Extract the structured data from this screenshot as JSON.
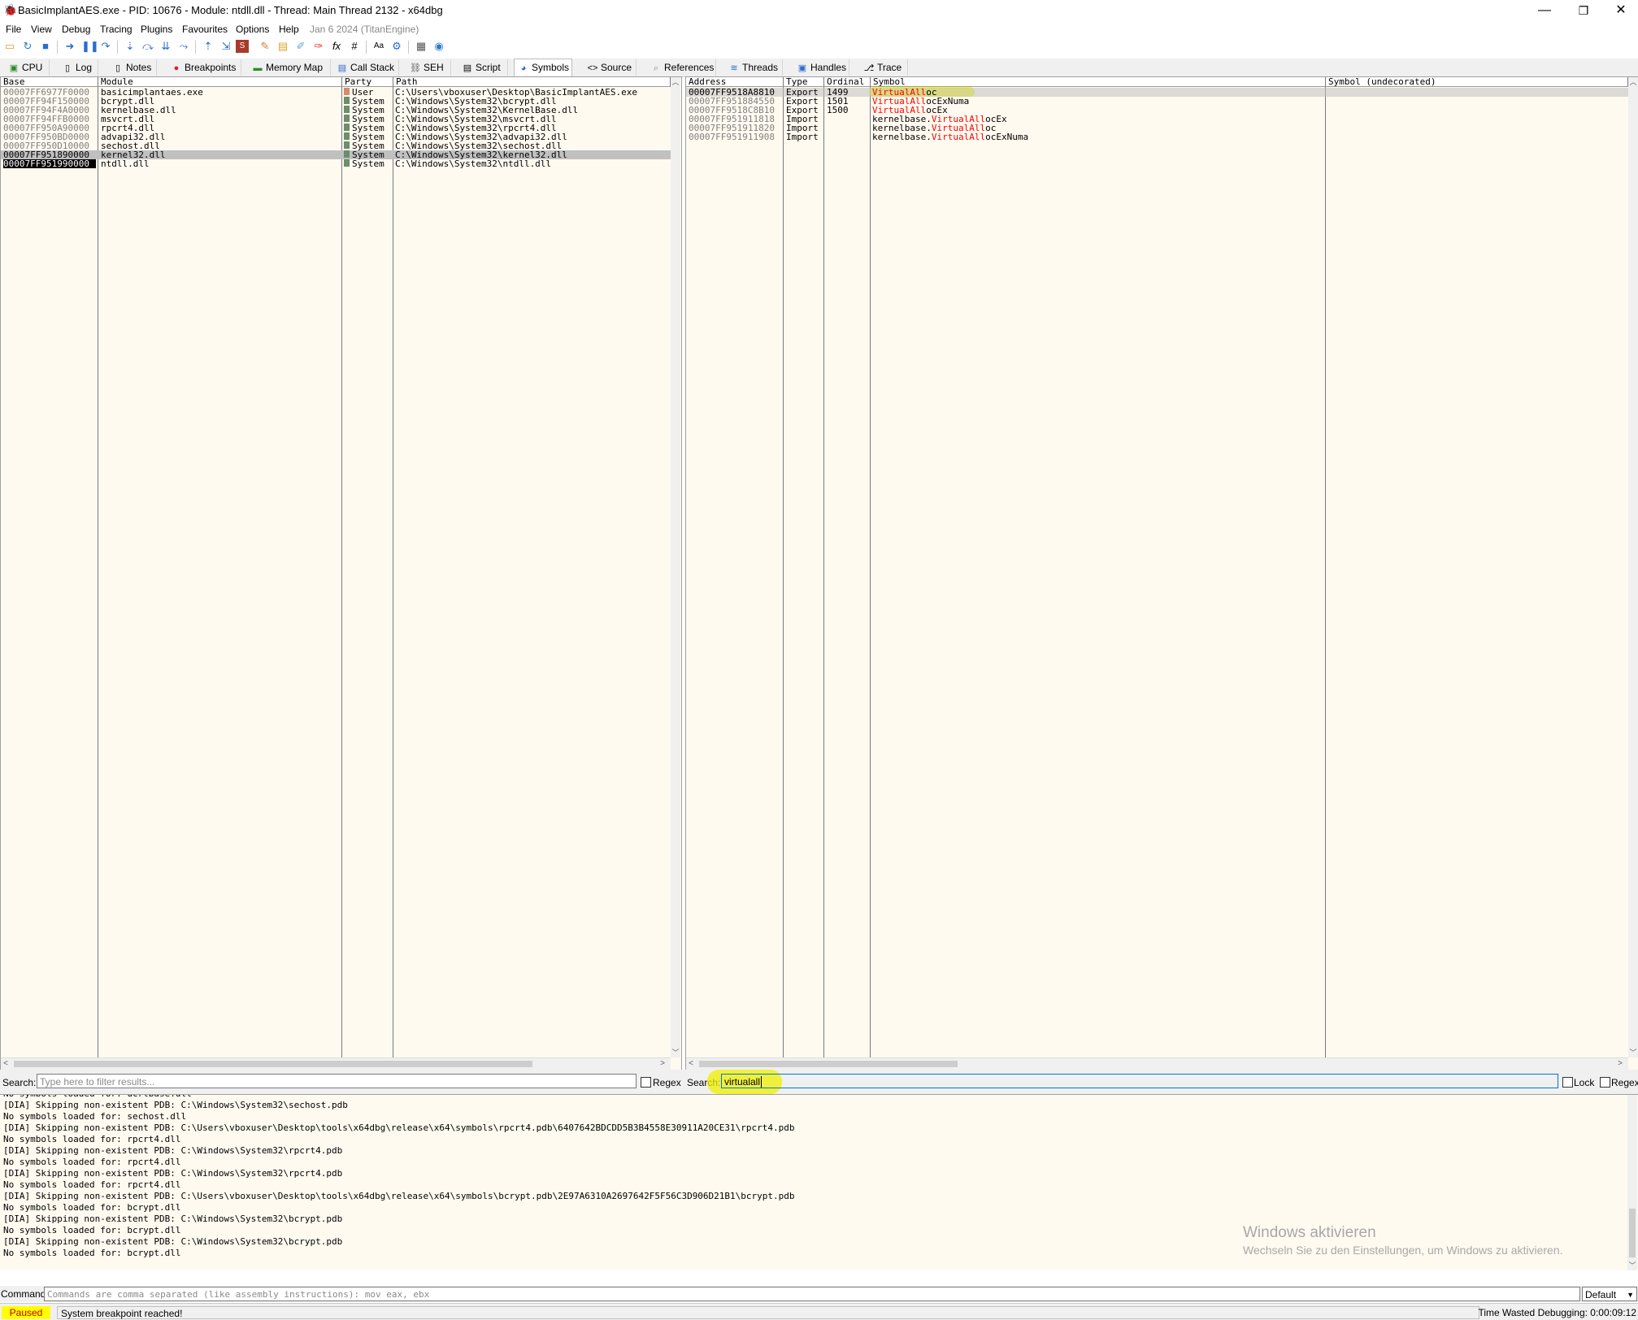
{
  "window": {
    "title": "BasicImplantAES.exe - PID: 10676 - Module: ntdll.dll - Thread: Main Thread 2132 - x64dbg",
    "minimize": "—",
    "restore": "❐",
    "close": "✕"
  },
  "menu": {
    "items": [
      "File",
      "View",
      "Debug",
      "Tracing",
      "Plugins",
      "Favourites",
      "Options",
      "Help"
    ],
    "date": "Jan 6 2024 (TitanEngine)"
  },
  "toolbar": {
    "icons": [
      "open-icon",
      "restart-icon",
      "stop-icon",
      "run-icon",
      "pause-icon",
      "run-until-return-icon",
      "step-into-icon",
      "step-over-icon",
      "trace-into-icon",
      "trace-over-icon",
      "execute-till-return-icon",
      "run-to-user-code-icon",
      "scylla-icon",
      "patch-icon",
      "comments-icon",
      "labels-icon",
      "bookmarks-icon",
      "functions-icon",
      "variables-icon",
      "hash-icon",
      "font-icon",
      "settings-icon",
      "calculator-icon",
      "help-icon"
    ]
  },
  "tabs": [
    {
      "label": "CPU",
      "icon": "cpu-icon"
    },
    {
      "label": "Log",
      "icon": "log-icon"
    },
    {
      "label": "Notes",
      "icon": "notes-icon"
    },
    {
      "label": "Breakpoints",
      "icon": "breakpoint-icon"
    },
    {
      "label": "Memory Map",
      "icon": "memory-icon"
    },
    {
      "label": "Call Stack",
      "icon": "callstack-icon"
    },
    {
      "label": "SEH",
      "icon": "seh-icon"
    },
    {
      "label": "Script",
      "icon": "script-icon"
    },
    {
      "label": "Symbols",
      "icon": "symbols-icon",
      "active": true
    },
    {
      "label": "Source",
      "icon": "source-icon"
    },
    {
      "label": "References",
      "icon": "references-icon"
    },
    {
      "label": "Threads",
      "icon": "threads-icon"
    },
    {
      "label": "Handles",
      "icon": "handles-icon"
    },
    {
      "label": "Trace",
      "icon": "trace-icon"
    }
  ],
  "modules": {
    "headers": {
      "base": "Base",
      "module": "Module",
      "party": "Party",
      "path": "Path"
    },
    "rows": [
      {
        "base": "00007FF6977F0000",
        "module": "basicimplantaes.exe",
        "party": "User",
        "path": "C:\\Users\\vboxuser\\Desktop\\BasicImplantAES.exe"
      },
      {
        "base": "00007FF94F150000",
        "module": "bcrypt.dll",
        "party": "System",
        "path": "C:\\Windows\\System32\\bcrypt.dll"
      },
      {
        "base": "00007FF94F4A0000",
        "module": "kernelbase.dll",
        "party": "System",
        "path": "C:\\Windows\\System32\\KernelBase.dll"
      },
      {
        "base": "00007FF94FFB0000",
        "module": "msvcrt.dll",
        "party": "System",
        "path": "C:\\Windows\\System32\\msvcrt.dll"
      },
      {
        "base": "00007FF950A90000",
        "module": "rpcrt4.dll",
        "party": "System",
        "path": "C:\\Windows\\System32\\rpcrt4.dll"
      },
      {
        "base": "00007FF950BD0000",
        "module": "advapi32.dll",
        "party": "System",
        "path": "C:\\Windows\\System32\\advapi32.dll"
      },
      {
        "base": "00007FF950D10000",
        "module": "sechost.dll",
        "party": "System",
        "path": "C:\\Windows\\System32\\sechost.dll"
      },
      {
        "base": "00007FF951890000",
        "module": "kernel32.dll",
        "party": "System",
        "path": "C:\\Windows\\System32\\kernel32.dll"
      },
      {
        "base": "00007FF951990000",
        "module": "ntdll.dll",
        "party": "System",
        "path": "C:\\Windows\\System32\\ntdll.dll"
      }
    ],
    "selected_row": 7,
    "focus_row": 8
  },
  "symbols": {
    "headers": {
      "address": "Address",
      "type": "Type",
      "ordinal": "Ordinal",
      "symbol": "Symbol",
      "undecorated": "Symbol (undecorated)"
    },
    "rows": [
      {
        "address": "00007FF9518A8810",
        "type": "Export",
        "ordinal": "1499",
        "prefix": "",
        "match": "VirtualAll",
        "suffix": "oc"
      },
      {
        "address": "00007FF951884550",
        "type": "Export",
        "ordinal": "1501",
        "prefix": "",
        "match": "VirtualAll",
        "suffix": "ocExNuma"
      },
      {
        "address": "00007FF9518C8B10",
        "type": "Export",
        "ordinal": "1500",
        "prefix": "",
        "match": "VirtualAll",
        "suffix": "ocEx"
      },
      {
        "address": "00007FF951911818",
        "type": "Import",
        "ordinal": "",
        "prefix": "kernelbase.",
        "match": "VirtualAll",
        "suffix": "ocEx"
      },
      {
        "address": "00007FF951911820",
        "type": "Import",
        "ordinal": "",
        "prefix": "kernelbase.",
        "match": "VirtualAll",
        "suffix": "oc"
      },
      {
        "address": "00007FF951911908",
        "type": "Import",
        "ordinal": "",
        "prefix": "kernelbase.",
        "match": "VirtualAll",
        "suffix": "ocExNuma"
      }
    ],
    "selected_row": 0
  },
  "search": {
    "label": "Search:",
    "left_placeholder": "Type here to filter results...",
    "regex_label": "Regex",
    "right_value": "virtualall",
    "lock_label": "Lock"
  },
  "log": {
    "lines": [
      "No symbols loaded for: ucrtbase.dll",
      "[DIA] Skipping non-existent PDB: C:\\Windows\\System32\\sechost.pdb",
      "No symbols loaded for: sechost.dll",
      "[DIA] Skipping non-existent PDB: C:\\Users\\vboxuser\\Desktop\\tools\\x64dbg\\release\\x64\\symbols\\rpcrt4.pdb\\6407642BDCDD5B3B4558E30911A20CE31\\rpcrt4.pdb",
      "No symbols loaded for: rpcrt4.dll",
      "[DIA] Skipping non-existent PDB: C:\\Windows\\System32\\rpcrt4.pdb",
      "No symbols loaded for: rpcrt4.dll",
      "[DIA] Skipping non-existent PDB: C:\\Windows\\System32\\rpcrt4.pdb",
      "No symbols loaded for: rpcrt4.dll",
      "[DIA] Skipping non-existent PDB: C:\\Users\\vboxuser\\Desktop\\tools\\x64dbg\\release\\x64\\symbols\\bcrypt.pdb\\2E97A6310A2697642F5F56C3D906D21B1\\bcrypt.pdb",
      "No symbols loaded for: bcrypt.dll",
      "[DIA] Skipping non-existent PDB: C:\\Windows\\System32\\bcrypt.pdb",
      "No symbols loaded for: bcrypt.dll",
      "[DIA] Skipping non-existent PDB: C:\\Windows\\System32\\bcrypt.pdb",
      "No symbols loaded for: bcrypt.dll"
    ],
    "watermark_title": "Windows aktivieren",
    "watermark_sub": "Wechseln Sie zu den Einstellungen, um Windows zu aktivieren."
  },
  "command": {
    "label": "Command:",
    "placeholder": "Commands are comma separated (like assembly instructions): mov eax, ebx",
    "dropdown_value": "Default"
  },
  "status": {
    "state": "Paused",
    "message": "System breakpoint reached!",
    "time": "Time Wasted Debugging: 0:00:09:12"
  },
  "colors": {
    "accent_highlight": "#ffff00",
    "match_text": "#ff0000",
    "pane_background": "#fffaf0",
    "status_paused_bg": "#ffff00"
  }
}
